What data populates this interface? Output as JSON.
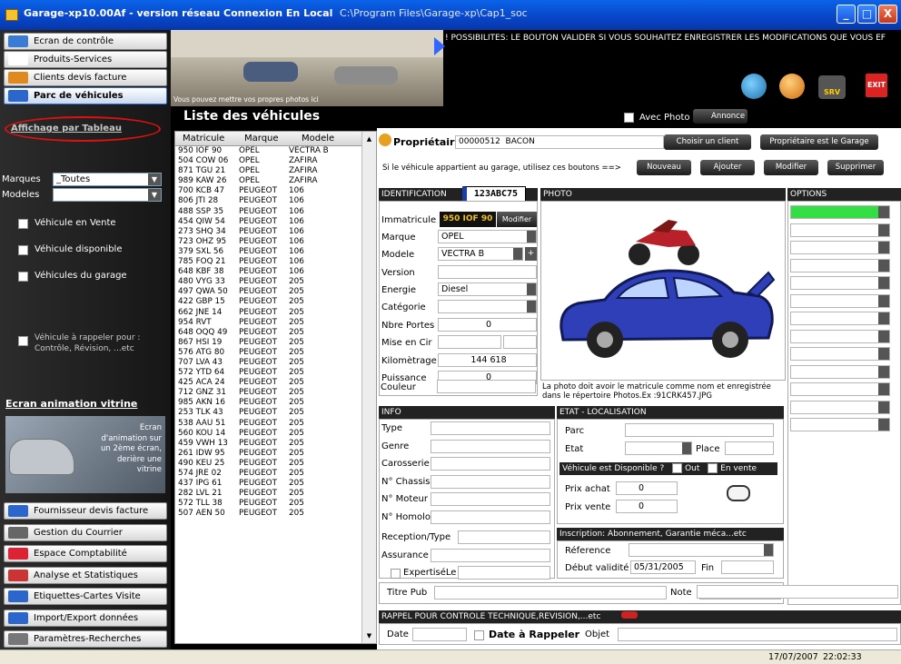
{
  "window": {
    "title": "Garage-xp10.00Af - version réseau Connexion En Local",
    "path": "C:\\Program Files\\Garage-xp\\Cap1_soc",
    "minimize": "_",
    "maximize": "□",
    "close": "X"
  },
  "nav": {
    "top_items": [
      {
        "label": "Ecran de contrôle",
        "icon": "monitor-icon",
        "color": "#3a7bd5"
      },
      {
        "label": "Produits-Services",
        "icon": "keyboard-icon",
        "color": "#ffffff"
      },
      {
        "label": "Clients devis facture",
        "icon": "people-icon",
        "color": "#e08a1e"
      },
      {
        "label": "Parc de véhicules",
        "icon": "car-icon",
        "color": "#2a66cc"
      }
    ],
    "table_link": "Affichage par Tableau",
    "marques_label": "Marques",
    "marques_value": "_Toutes",
    "modeles_label": "Modeles",
    "modeles_value": "",
    "checks": [
      "Véhicule en Vente",
      "Véhicule disponible",
      "Véhicules du garage"
    ],
    "rappel_check": "Véhicule à rappeler pour : Contrôle, Révision, ...etc",
    "animation_link": "Ecran animation vitrine",
    "animation_text": "Ecran d'animation sur un 2ème écran, derière une vitrine",
    "bottom_items": [
      {
        "label": "Fournisseur devis facture",
        "icon": "truck-icon",
        "color": "#2a66cc"
      },
      {
        "label": "Gestion du Courrier",
        "icon": "mail-icon",
        "color": "#666666"
      },
      {
        "label": "Espace Comptabilité",
        "icon": "chart-icon",
        "color": "#d23"
      },
      {
        "label": "Analyse et Statistiques",
        "icon": "pie-icon",
        "color": "#c33"
      },
      {
        "label": "Etiquettes-Cartes Visite",
        "icon": "label-icon",
        "color": "#2a66cc"
      },
      {
        "label": "Import/Export données",
        "icon": "transfer-icon",
        "color": "#2a66cc"
      },
      {
        "label": "Paramètres-Recherches",
        "icon": "wrench-icon",
        "color": "#777"
      }
    ]
  },
  "banner": {
    "photo_caption": "Vous pouvez mettre vos propres photos ici",
    "marquee": "! POSSIBILITES: LE BOUTON VALIDER SI VOUS SOUHAITEZ ENREGISTRER LES MODIFICATIONS QUE VOUS EF",
    "srv_label": "SRV",
    "exit_label": "EXIT"
  },
  "list": {
    "title": "Liste des véhicules",
    "avec_photo": "Avec Photo",
    "annonce": "Annonce",
    "headers": {
      "matricule": "Matricule",
      "marque": "Marque",
      "modele": "Modele"
    },
    "rows": [
      [
        "950 IOF 90",
        "OPEL",
        "VECTRA B"
      ],
      [
        "504 COW 06",
        "OPEL",
        "ZAFIRA"
      ],
      [
        "871 TGU 21",
        "OPEL",
        "ZAFIRA"
      ],
      [
        "989 KAW 26",
        "OPEL",
        "ZAFIRA"
      ],
      [
        "700 KCB 47",
        "PEUGEOT",
        "106"
      ],
      [
        "806 JTI 28",
        "PEUGEOT",
        "106"
      ],
      [
        "488 SSP 35",
        "PEUGEOT",
        "106"
      ],
      [
        "454 QIW 54",
        "PEUGEOT",
        "106"
      ],
      [
        "273 SHQ 34",
        "PEUGEOT",
        "106"
      ],
      [
        "723 OHZ 95",
        "PEUGEOT",
        "106"
      ],
      [
        "379 SXL 56",
        "PEUGEOT",
        "106"
      ],
      [
        "785 FOQ 21",
        "PEUGEOT",
        "106"
      ],
      [
        "648 KBF 38",
        "PEUGEOT",
        "106"
      ],
      [
        "480 VYG 33",
        "PEUGEOT",
        "205"
      ],
      [
        "497 QWA 50",
        "PEUGEOT",
        "205"
      ],
      [
        "422 GBP 15",
        "PEUGEOT",
        "205"
      ],
      [
        "662 JNE 14",
        "PEUGEOT",
        "205"
      ],
      [
        "954 RVT",
        "PEUGEOT",
        "205"
      ],
      [
        "648 OQQ 49",
        "PEUGEOT",
        "205"
      ],
      [
        "867 HSI 19",
        "PEUGEOT",
        "205"
      ],
      [
        "576 ATG 80",
        "PEUGEOT",
        "205"
      ],
      [
        "707 LVA 43",
        "PEUGEOT",
        "205"
      ],
      [
        "572 YTD 64",
        "PEUGEOT",
        "205"
      ],
      [
        "425 ACA 24",
        "PEUGEOT",
        "205"
      ],
      [
        "712 GNZ 31",
        "PEUGEOT",
        "205"
      ],
      [
        "985 AKN 16",
        "PEUGEOT",
        "205"
      ],
      [
        "253 TLK 43",
        "PEUGEOT",
        "205"
      ],
      [
        "538 AAU 51",
        "PEUGEOT",
        "205"
      ],
      [
        "560 KOU 14",
        "PEUGEOT",
        "205"
      ],
      [
        "459 VWH 13",
        "PEUGEOT",
        "205"
      ],
      [
        "261 IDW 95",
        "PEUGEOT",
        "205"
      ],
      [
        "490 KEU 25",
        "PEUGEOT",
        "205"
      ],
      [
        "574 JRE 02",
        "PEUGEOT",
        "205"
      ],
      [
        "437 IPG 61",
        "PEUGEOT",
        "205"
      ],
      [
        "282 LVL 21",
        "PEUGEOT",
        "205"
      ],
      [
        "572 TLL 38",
        "PEUGEOT",
        "205"
      ],
      [
        "507 AEN 50",
        "PEUGEOT",
        "205"
      ]
    ]
  },
  "owner": {
    "label": "Propriétaire",
    "code": "00000512",
    "name": "BACON",
    "choose_btn": "Choisir un client",
    "garage_btn": "Propriétaire est le Garage",
    "hint": "Si le véhicule appartient au garage, utilisez ces boutons ==>",
    "btn_new": "Nouveau",
    "btn_add": "Ajouter",
    "btn_edit": "Modifier",
    "btn_delete": "Supprimer"
  },
  "identification": {
    "title": "IDENTIFICATION",
    "plate_badge": "123ABC75",
    "immatricule_label": "Immatricule",
    "immatricule_value": "950 IOF 90",
    "modifier": "Modifier",
    "marque_label": "Marque",
    "marque_value": "OPEL",
    "modele_label": "Modele",
    "modele_value": "VECTRA B",
    "version_label": "Version",
    "energie_label": "Energie",
    "energie_value": "Diesel",
    "categorie_label": "Catégorie",
    "portes_label": "Nbre Portes",
    "portes_value": "0",
    "mise_label": "Mise en Cir",
    "km_label": "Kilomètrage",
    "km_value": "144 618",
    "puissance_label": "Puissance",
    "puissance_value": "0",
    "couleur_label": "Couleur"
  },
  "photo": {
    "title": "PHOTO",
    "note": "La photo doit avoir le matricule comme nom et enregistrée dans le répertoire Photos.Ex :91CRK457.JPG"
  },
  "options": {
    "title": "OPTIONS",
    "count": 13
  },
  "info": {
    "title": "INFO",
    "fields": [
      "Type",
      "Genre",
      "Carosserie",
      "N° Chassis",
      "N° Moteur",
      "N° Homolo"
    ],
    "reception_label": "Reception/Type",
    "assurance_label": "Assurance",
    "expertise_label": "ExpertiséLe"
  },
  "etat": {
    "title": "ETAT - LOCALISATION",
    "parc_label": "Parc",
    "etat_label": "Etat",
    "place_label": "Place",
    "dispo_label": "Véhicule est Disponible ?",
    "out_label": "Out",
    "vente_label": "En vente",
    "prix_achat_label": "Prix achat",
    "prix_achat_value": "0",
    "prix_vente_label": "Prix vente",
    "prix_vente_value": "0"
  },
  "inscription": {
    "title": "Inscription: Abonnement, Garantie méca...etc",
    "reference_label": "Réference",
    "debut_label": "Début validité",
    "debut_value": "05/31/2005",
    "fin_label": "Fin"
  },
  "pub": {
    "titre_label": "Titre Pub",
    "note_label": "Note"
  },
  "rappel": {
    "title": "RAPPEL POUR CONTROLE TECHNIQUE,REVISION,...etc",
    "date_label": "Date",
    "date_rappel_label": "Date à Rappeler",
    "objet_label": "Objet"
  },
  "status": {
    "date": "17/07/2007",
    "time": "22:02:33"
  }
}
